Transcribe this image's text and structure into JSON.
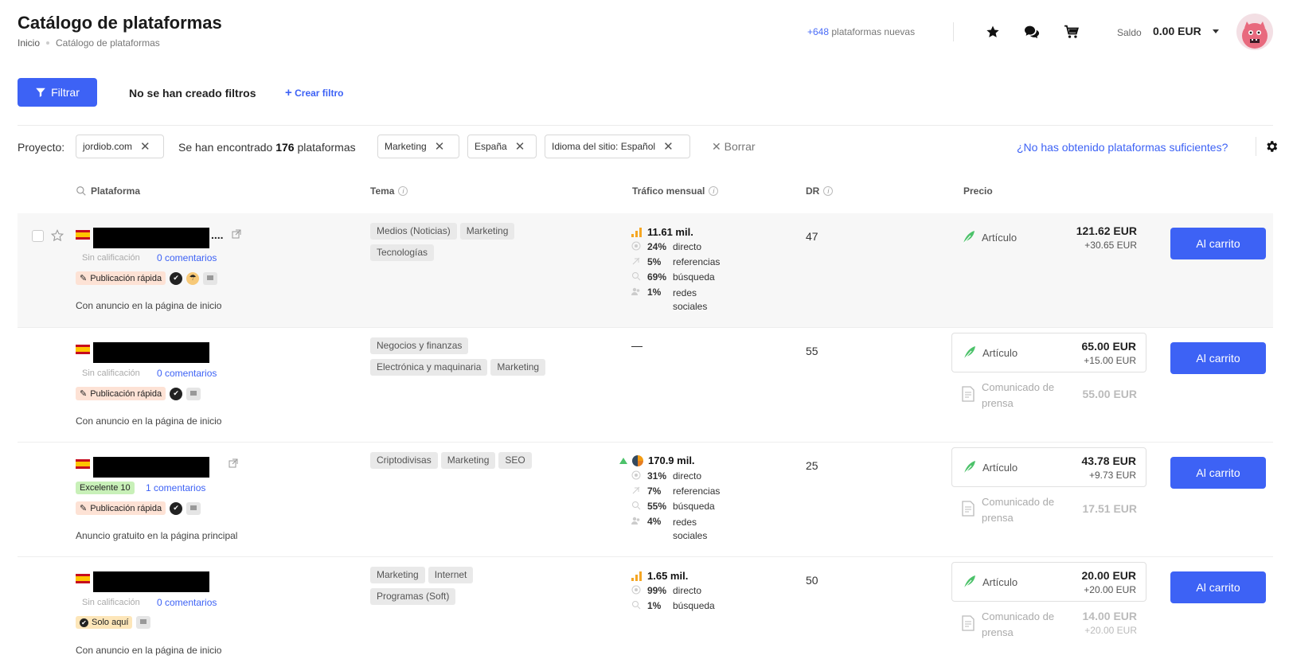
{
  "header": {
    "title": "Catálogo de plataformas",
    "breadcrumb": [
      "Inicio",
      "Catálogo de plataformas"
    ],
    "new_count": "+648",
    "new_label": "plataformas nuevas",
    "saldo_label": "Saldo",
    "saldo_value": "0.00 EUR"
  },
  "filters": {
    "filter_button": "Filtrar",
    "no_filters": "No se han creado filtros",
    "create_filter": "Crear filtro",
    "project_label": "Proyecto:",
    "project_value": "jordiob.com",
    "found_prefix": "Se han encontrado",
    "found_count": "176",
    "found_suffix": "plataformas",
    "chips": [
      "Marketing",
      "España",
      "Idioma del sitio: Español"
    ],
    "clear_label": "Borrar",
    "not_enough": "¿No has obtenido plataformas suficientes?"
  },
  "table": {
    "columns": {
      "platform": "Plataforma",
      "topic": "Tema",
      "traffic": "Tráfico mensual",
      "dr": "DR",
      "price": "Precio"
    },
    "cart_label": "Al carrito",
    "article_label": "Artículo",
    "press_label": "Comunicado de prensa",
    "fast_label": "Publicación rápida",
    "rows": [
      {
        "rating": "Sin calificación",
        "comments": "0 comentarios",
        "ad_text": "Con anuncio en la página de inicio",
        "topics": [
          "Medios (Noticias)",
          "Marketing",
          "Tecnologías"
        ],
        "traffic_total": "11.61 mil.",
        "traffic_lines": [
          {
            "pct": "24%",
            "label": "directo"
          },
          {
            "pct": "5%",
            "label": "referencias"
          },
          {
            "pct": "69%",
            "label": "búsqueda"
          },
          {
            "pct": "1%",
            "label": "redes sociales"
          }
        ],
        "dr": "47",
        "article_price": "121.62 EUR",
        "article_sub": "+30.65 EUR"
      },
      {
        "rating": "Sin calificación",
        "comments": "0 comentarios",
        "ad_text": "Con anuncio en la página de inicio",
        "topics": [
          "Negocios y finanzas",
          "Electrónica y maquinaria",
          "Marketing"
        ],
        "traffic_empty": "—",
        "dr": "55",
        "article_price": "65.00 EUR",
        "article_sub": "+15.00 EUR",
        "press_price": "55.00 EUR"
      },
      {
        "rating": "Excelente 10",
        "comments": "1 comentarios",
        "ad_text": "Anuncio gratuito en la página principal",
        "topics": [
          "Criptodivisas",
          "Marketing",
          "SEO"
        ],
        "traffic_total": "170.9 mil.",
        "traffic_lines": [
          {
            "pct": "31%",
            "label": "directo"
          },
          {
            "pct": "7%",
            "label": "referencias"
          },
          {
            "pct": "55%",
            "label": "búsqueda"
          },
          {
            "pct": "4%",
            "label": "redes sociales"
          }
        ],
        "dr": "25",
        "article_price": "43.78 EUR",
        "article_sub": "+9.73 EUR",
        "press_price": "17.51 EUR"
      },
      {
        "rating": "Sin calificación",
        "comments": "0 comentarios",
        "badge_only": "Solo aquí",
        "ad_text": "Con anuncio en la página de inicio",
        "topics": [
          "Marketing",
          "Internet",
          "Programas (Soft)"
        ],
        "traffic_total": "1.65 mil.",
        "traffic_lines": [
          {
            "pct": "99%",
            "label": "directo"
          },
          {
            "pct": "1%",
            "label": "búsqueda"
          }
        ],
        "dr": "50",
        "article_price": "20.00 EUR",
        "article_sub": "+20.00 EUR",
        "press_price": "14.00 EUR",
        "press_sub": "+20.00 EUR"
      }
    ]
  },
  "colors": {
    "accent": "#3d62f5",
    "fast_badge": "#fde2d5",
    "good_rating": "#c8f0b8"
  }
}
